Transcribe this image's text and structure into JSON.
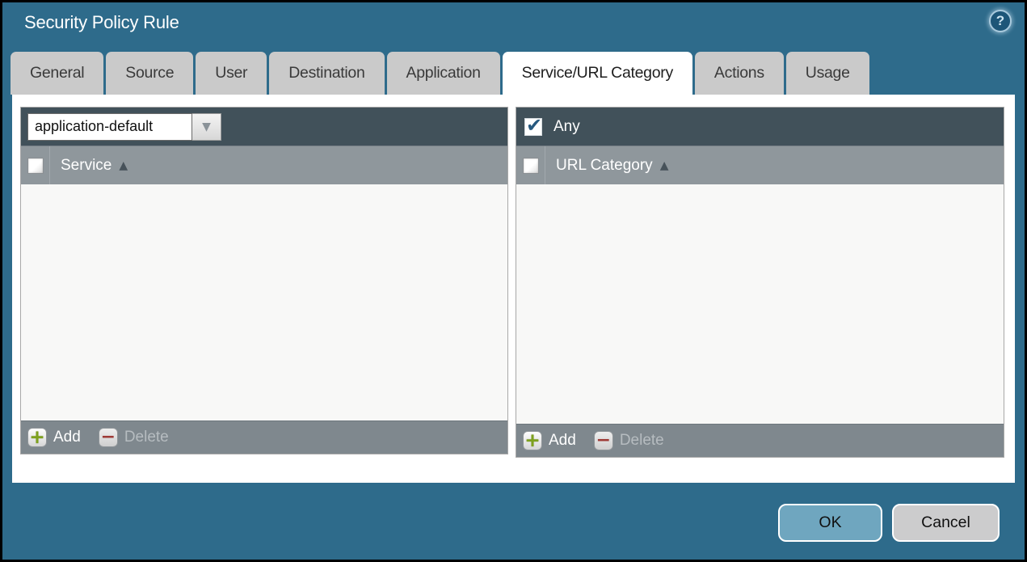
{
  "window": {
    "title": "Security Policy Rule"
  },
  "tabs": [
    {
      "label": "General",
      "active": false
    },
    {
      "label": "Source",
      "active": false
    },
    {
      "label": "User",
      "active": false
    },
    {
      "label": "Destination",
      "active": false
    },
    {
      "label": "Application",
      "active": false
    },
    {
      "label": "Service/URL Category",
      "active": true
    },
    {
      "label": "Actions",
      "active": false
    },
    {
      "label": "Usage",
      "active": false
    }
  ],
  "service_panel": {
    "dropdown": {
      "value": "application-default"
    },
    "column_header": "Service",
    "rows": [],
    "add_label": "Add",
    "delete_label": "Delete",
    "delete_enabled": false
  },
  "url_category_panel": {
    "any_label": "Any",
    "any_checked": true,
    "column_header": "URL Category",
    "rows": [],
    "add_label": "Add",
    "delete_label": "Delete",
    "delete_enabled": false
  },
  "buttons": {
    "ok": "OK",
    "cancel": "Cancel"
  },
  "icons": {
    "help_glyph": "?",
    "dropdown_glyph": "▼",
    "sort_asc_glyph": "▲",
    "add_glyph": "+",
    "delete_glyph": "−",
    "check_glyph": "✔"
  },
  "colors": {
    "accent_teal": "#2e6b8b",
    "panel_header_dark": "#41515a",
    "column_header_gray": "#8f979c",
    "footer_gray": "#7f888e",
    "ok_button_blue": "#6fa6bf",
    "add_green": "#7ea11d",
    "delete_red": "#9e3a36"
  }
}
